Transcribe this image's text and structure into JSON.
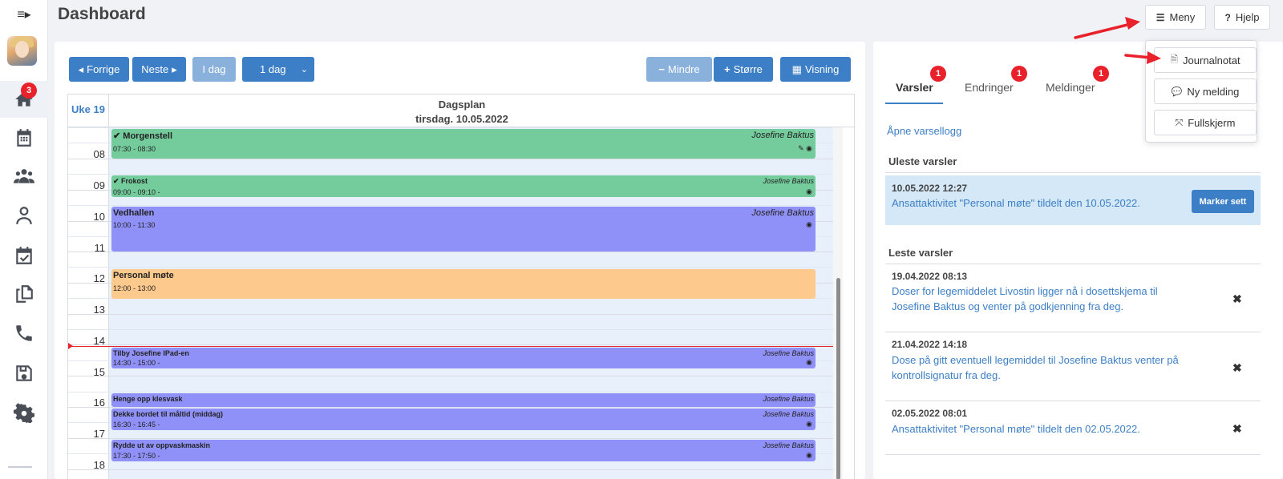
{
  "page": {
    "title": "Dashboard"
  },
  "sidebar": {
    "toggle_icon": "menu-toggle-icon",
    "items": [
      {
        "name": "home",
        "icon": "home-icon",
        "badge": "3",
        "active": true
      },
      {
        "name": "calendar",
        "icon": "calendar-icon"
      },
      {
        "name": "users",
        "icon": "users-icon"
      },
      {
        "name": "profile",
        "icon": "person-icon"
      },
      {
        "name": "tasks",
        "icon": "calendar-check-icon"
      },
      {
        "name": "documents",
        "icon": "documents-icon"
      },
      {
        "name": "phone",
        "icon": "phone-icon"
      },
      {
        "name": "save",
        "icon": "save-icon"
      },
      {
        "name": "settings",
        "icon": "gear-icon"
      }
    ]
  },
  "topbar": {
    "menu_label": "Meny",
    "help_label": "Hjelp",
    "menu_items": [
      {
        "label": "Journalnotat",
        "icon": "document-icon"
      },
      {
        "label": "Ny melding",
        "icon": "chat-icon"
      },
      {
        "label": "Fullskjerm",
        "icon": "fullscreen-icon"
      }
    ]
  },
  "calendar": {
    "prev_label": "Forrige",
    "next_label": "Neste",
    "today_label": "I dag",
    "range_label": "1 dag",
    "smaller_label": "Mindre",
    "bigger_label": "Større",
    "view_label": "Visning",
    "week_label": "Uke 19",
    "day_title": "Dagsplan",
    "day_date": "tirsdag. 10.05.2022",
    "hours": [
      "08",
      "09",
      "10",
      "11",
      "12",
      "13",
      "14",
      "15",
      "16",
      "17",
      "18"
    ],
    "events": [
      {
        "title": "Morgenstell",
        "time": "07:30 - 08:30",
        "owner": "Josefine Baktus",
        "color": "green",
        "done": true
      },
      {
        "title": "Frokost",
        "time": "09:00 - 09:10  -",
        "owner": "Josefine Baktus",
        "color": "green",
        "done": true
      },
      {
        "title": "Vedhallen",
        "time": "10:00 - 11:30",
        "owner": "Josefine Baktus",
        "color": "purple"
      },
      {
        "title": "Personal møte",
        "time": "12:00 - 13:00",
        "owner": "",
        "color": "orange"
      },
      {
        "title": "Tilby Josefine IPad-en",
        "time": "14:30 - 15:00  -",
        "owner": "Josefine Baktus",
        "color": "purple"
      },
      {
        "title": "Henge opp klesvask",
        "time": "",
        "owner": "Josefine Baktus",
        "color": "purple"
      },
      {
        "title": "Dekke bordet til måltid (middag)",
        "time": "16:30 - 16:45  -",
        "owner": "Josefine Baktus",
        "color": "purple"
      },
      {
        "title": "Rydde ut av oppvaskmaskin",
        "time": "17:30 - 17:50  -",
        "owner": "Josefine Baktus",
        "color": "purple"
      }
    ]
  },
  "notifications": {
    "tabs": [
      {
        "label": "Varsler",
        "badge": "1"
      },
      {
        "label": "Endringer",
        "badge": "1"
      },
      {
        "label": "Meldinger",
        "badge": "1"
      }
    ],
    "open_log": "Åpne varsellogg",
    "unread_title": "Uleste varsler",
    "unread": [
      {
        "date": "10.05.2022 12:27",
        "text": "Ansattaktivitet \"Personal møte\" tildelt den 10.05.2022.",
        "action": "Marker sett"
      }
    ],
    "read_title": "Leste varsler",
    "read": [
      {
        "date": "19.04.2022 08:13",
        "text": "Doser for legemiddelet Livostin ligger nå i dosettskjema til Josefine Baktus og venter på godkjenning fra deg."
      },
      {
        "date": "21.04.2022 14:18",
        "text": "Dose på gitt eventuell legemiddel til Josefine Baktus venter på kontrollsignatur fra deg."
      },
      {
        "date": "02.05.2022 08:01",
        "text": "Ansattaktivitet \"Personal møte\" tildelt den 02.05.2022."
      }
    ]
  },
  "colors": {
    "primary": "#3d7fc6",
    "event_green": "#74cc9d",
    "event_purple": "#9091f8",
    "event_orange": "#fdc98d",
    "badge_red": "#e8212b",
    "arrow_red": "#e8212b"
  }
}
